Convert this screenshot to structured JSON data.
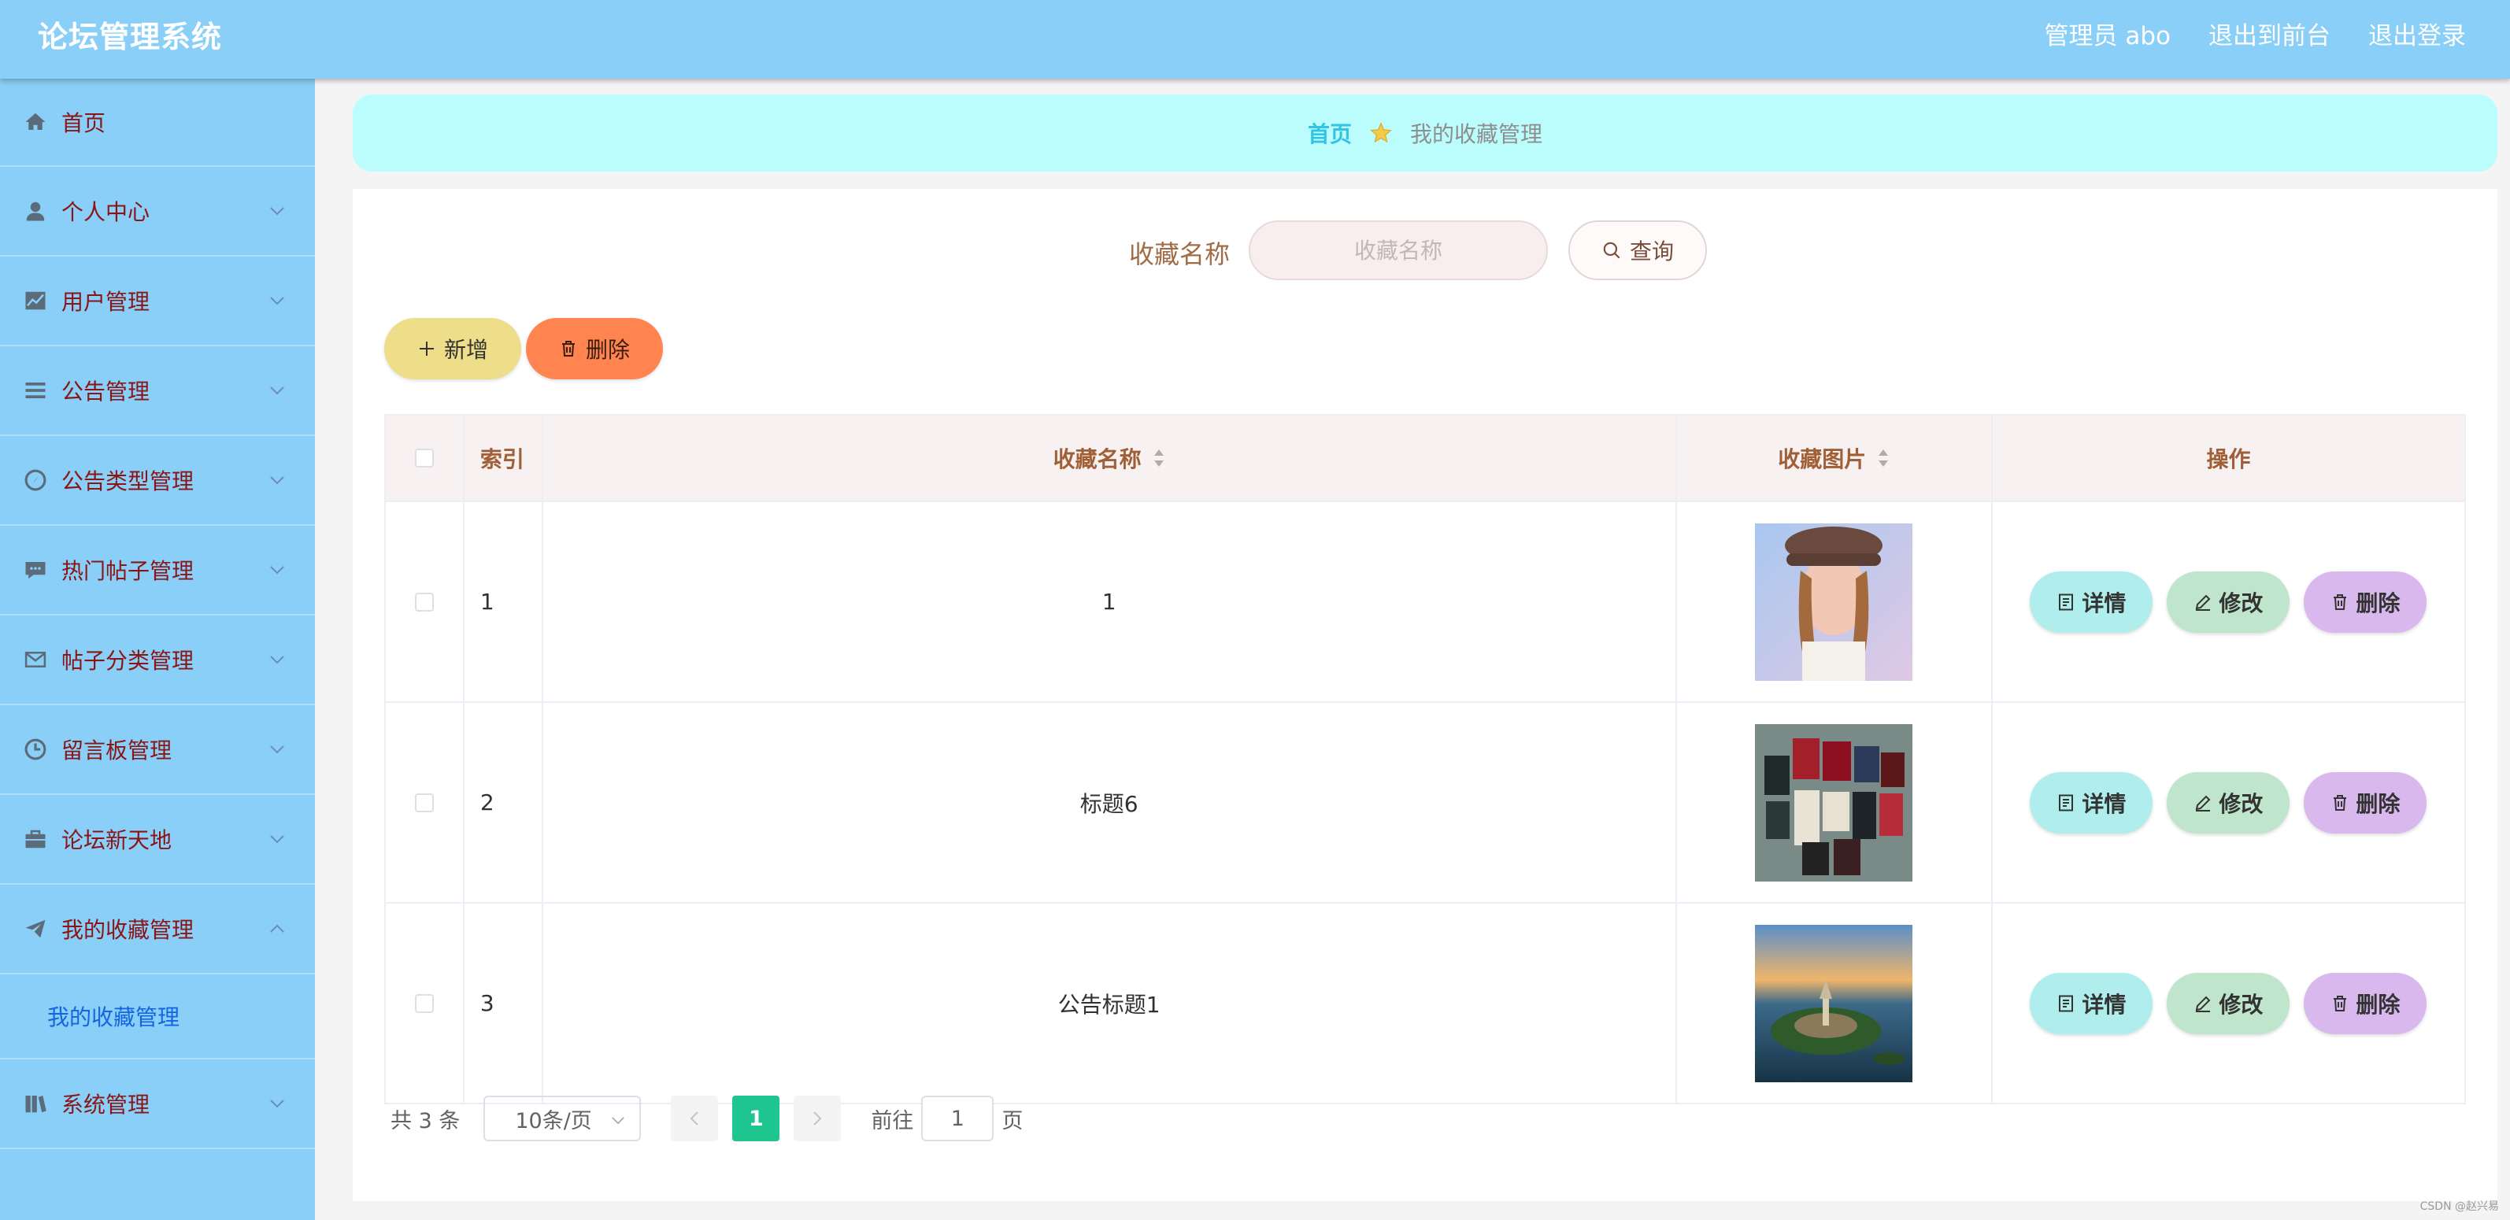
{
  "header": {
    "app_title": "论坛管理系统",
    "admin_label": "管理员 abo",
    "to_frontend": "退出到前台",
    "logout": "退出登录"
  },
  "sidebar": {
    "items": [
      {
        "label": "首页",
        "icon": "home-icon"
      },
      {
        "label": "个人中心",
        "icon": "user-icon"
      },
      {
        "label": "用户管理",
        "icon": "chart-icon"
      },
      {
        "label": "公告管理",
        "icon": "list-icon"
      },
      {
        "label": "公告类型管理",
        "icon": "compass-icon"
      },
      {
        "label": "热门帖子管理",
        "icon": "chat-icon"
      },
      {
        "label": "帖子分类管理",
        "icon": "mail-icon"
      },
      {
        "label": "留言板管理",
        "icon": "clock-icon"
      },
      {
        "label": "论坛新天地",
        "icon": "briefcase-icon"
      },
      {
        "label": "我的收藏管理",
        "icon": "send-icon"
      },
      {
        "label": "系统管理",
        "icon": "books-icon"
      }
    ],
    "submenu_label": "我的收藏管理"
  },
  "breadcrumb": {
    "home": "首页",
    "current": "我的收藏管理"
  },
  "search": {
    "label": "收藏名称",
    "placeholder": "收藏名称",
    "button": "查询"
  },
  "actions": {
    "add": "新增",
    "delete": "删除"
  },
  "table": {
    "columns": {
      "index": "索引",
      "name": "收藏名称",
      "image": "收藏图片",
      "ops": "操作"
    },
    "rows": [
      {
        "index": "1",
        "name": "1",
        "image": "portrait-photo"
      },
      {
        "index": "2",
        "name": "标题6",
        "image": "certificates-photo"
      },
      {
        "index": "3",
        "name": "公告标题1",
        "image": "island-aerial-photo"
      }
    ],
    "op_labels": {
      "detail": "详情",
      "edit": "修改",
      "delete": "删除"
    }
  },
  "pagination": {
    "total": "共 3 条",
    "page_size": "10条/页",
    "current_page": "1",
    "goto_prefix": "前往",
    "goto_value": "1",
    "goto_suffix": "页"
  },
  "watermark": "CSDN @赵兴易",
  "colors": {
    "header_bg": "#89cff7",
    "sidebar_bg": "#89cff7",
    "breadcrumb_bg": "#bbfdfd",
    "add_button": "#eede8a",
    "delete_button": "#ff8450",
    "detail_button": "#b0eeee",
    "edit_button": "#bfe6cc",
    "row_delete_button": "#d9b8ee",
    "pager_active": "#1ec58e"
  }
}
